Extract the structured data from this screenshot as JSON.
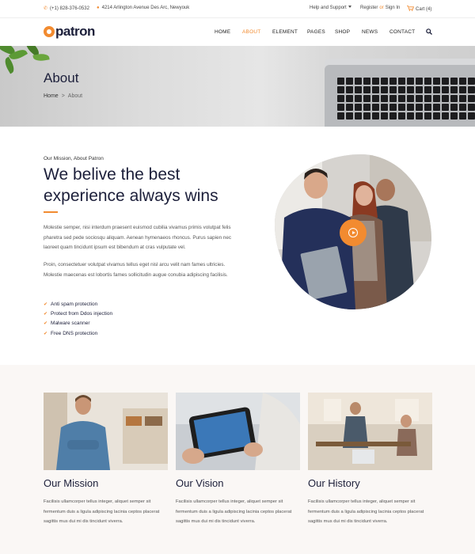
{
  "topbar": {
    "phone": "(+1) 828-376-0532",
    "address": "4214 Arlington Avenue Des Arc, Newyouk",
    "help": "Help and Support",
    "register": "Register",
    "or": "or",
    "signin": "Sign In",
    "cart": "Cart (4)"
  },
  "brand": {
    "name": "patron",
    "accent": "#f28b30"
  },
  "nav": {
    "home": "HOME",
    "about": "ABOUT",
    "element": "ELEMENT",
    "pages": "PAGES",
    "shop": "SHOP",
    "news": "NEWS",
    "contact": "CONTACT"
  },
  "banner": {
    "title": "About",
    "crumb_home": "Home",
    "crumb_sep": ">",
    "crumb_current": "About"
  },
  "about": {
    "kicker": "Our Mission, About Patron",
    "headline": "We belive the best experience always wins",
    "para1": "Molestie semper, nisi interdum praesent euismod cubilia vivamus primis volutpat felis pharetra sed pede sociosqu aliquam. Aenean hymenaeos rhoncus. Purus sapien nec laoreet quam tincidunt ipsum est bibendum at cras vulputate vel.",
    "para2": "Proin, consectetuer volutpat vivamus tellus eget nisl arcu velit nam fames ultricies. Molestie maecenas est lobortis fames sollicitudin augue conubia adipiscing facilisis.",
    "features": [
      "Anti spam protection",
      "Protect from Ddos injection",
      "Malware scanner",
      "Free DNS protection"
    ]
  },
  "cards": [
    {
      "title": "Our Mission",
      "text": "Facilisis ullamcorper tellus integer, aliquet semper sit fermentum duis a ligula adipiscing lacinia ceptos placerat sagittis mus dui mi dis tincidunt viverra."
    },
    {
      "title": "Our Vision",
      "text": "Facilisis ullamcorper tellus integer, aliquet semper sit fermentum duis a ligula adipiscing lacinia ceptos placerat sagittis mus dui mi dis tincidunt viverra."
    },
    {
      "title": "Our History",
      "text": "Facilisis ullamcorper tellus integer, aliquet semper sit fermentum duis a ligula adipiscing lacinia ceptos placerat sagittis mus dui mi dis tincidunt viverra."
    }
  ]
}
